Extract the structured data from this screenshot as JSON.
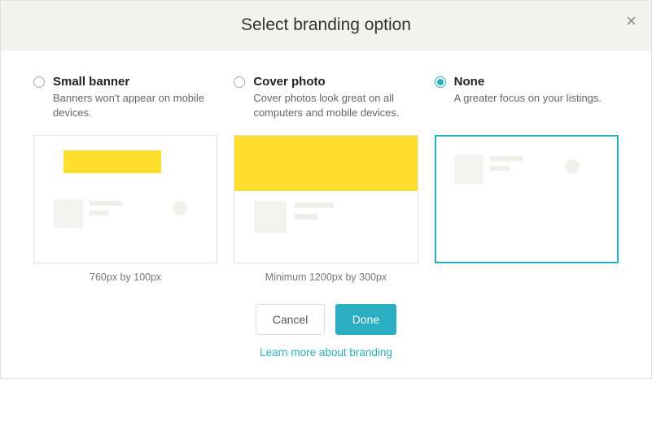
{
  "modal": {
    "title": "Select branding option",
    "close_label": "×"
  },
  "options": [
    {
      "title": "Small banner",
      "desc": "Banners won't appear on mobile devices.",
      "caption": "760px by 100px",
      "selected": false
    },
    {
      "title": "Cover photo",
      "desc": "Cover photos look great on all computers and mobile devices.",
      "caption": "Minimum 1200px by 300px",
      "selected": false
    },
    {
      "title": "None",
      "desc": "A greater focus on your listings.",
      "caption": "",
      "selected": true
    }
  ],
  "actions": {
    "cancel": "Cancel",
    "done": "Done"
  },
  "learn_more": "Learn more about branding"
}
